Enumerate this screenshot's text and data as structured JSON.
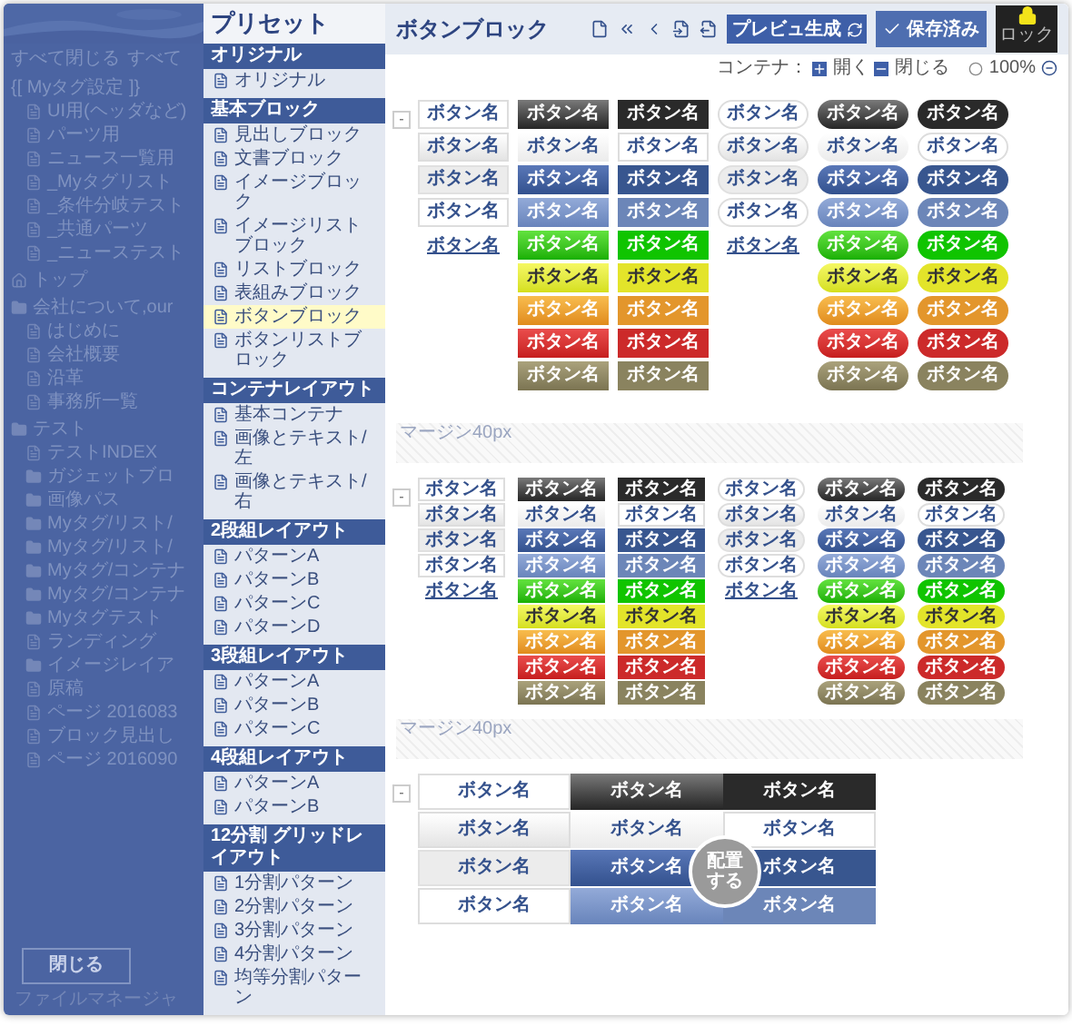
{
  "background_panel": {
    "toolbar": [
      "すべて閉じる",
      "すべて"
    ],
    "tree": [
      {
        "label": "{[ Myタグ設定 ]}",
        "kind": "plain",
        "children": [
          {
            "label": "UI用(ヘッダなど)",
            "kind": "page"
          },
          {
            "label": "パーツ用",
            "kind": "page"
          },
          {
            "label": "ニュース一覧用",
            "kind": "page"
          },
          {
            "label": "_Myタグリスト",
            "kind": "page"
          },
          {
            "label": "_条件分岐テスト",
            "kind": "page"
          },
          {
            "label": "_共通パーツ",
            "kind": "page"
          },
          {
            "label": "_ニューステスト",
            "kind": "page"
          }
        ]
      },
      {
        "label": "トップ",
        "kind": "home"
      },
      {
        "label": "会社について,our",
        "kind": "folder",
        "children": [
          {
            "label": "はじめに",
            "kind": "page"
          },
          {
            "label": "会社概要",
            "kind": "page"
          },
          {
            "label": "沿革",
            "kind": "page"
          },
          {
            "label": "事務所一覧",
            "kind": "page"
          }
        ]
      },
      {
        "label": "テスト",
        "kind": "folder",
        "children": [
          {
            "label": "テストINDEX",
            "kind": "page"
          },
          {
            "label": "ガジェットブロ",
            "kind": "folder"
          },
          {
            "label": "画像パス",
            "kind": "folder"
          },
          {
            "label": "Myタグ/リスト/",
            "kind": "folder"
          },
          {
            "label": "Myタグ/リスト/",
            "kind": "folder"
          },
          {
            "label": "Myタグ/コンテナ",
            "kind": "folder"
          },
          {
            "label": "Myタグ/コンテナ",
            "kind": "folder"
          },
          {
            "label": "Myタグテスト",
            "kind": "folder"
          },
          {
            "label": "ランディング",
            "kind": "page"
          },
          {
            "label": "イメージレイア",
            "kind": "folder"
          },
          {
            "label": "原稿",
            "kind": "page"
          },
          {
            "label": "ページ 2016083",
            "kind": "page"
          },
          {
            "label": "ブロック見出し",
            "kind": "page"
          },
          {
            "label": "ページ 2016090",
            "kind": "page"
          }
        ]
      }
    ],
    "close_button": "閉じる",
    "footer": "ファイルマネージャ"
  },
  "presets": {
    "title": "プリセット",
    "groups": [
      {
        "title": "オリジナル",
        "items": [
          {
            "label": "オリジナル",
            "selected": false
          }
        ]
      },
      {
        "title": "基本ブロック",
        "items": [
          {
            "label": "見出しブロック",
            "selected": false
          },
          {
            "label": "文書ブロック",
            "selected": false
          },
          {
            "label": "イメージブロック",
            "selected": false
          },
          {
            "label": "イメージリストブロック",
            "selected": false
          },
          {
            "label": "リストブロック",
            "selected": false
          },
          {
            "label": "表組みブロック",
            "selected": false
          },
          {
            "label": "ボタンブロック",
            "selected": true
          },
          {
            "label": "ボタンリストブロック",
            "selected": false
          }
        ]
      },
      {
        "title": "コンテナレイアウト",
        "items": [
          {
            "label": "基本コンテナ",
            "selected": false
          },
          {
            "label": "画像とテキスト/左",
            "selected": false
          },
          {
            "label": "画像とテキスト/右",
            "selected": false
          }
        ]
      },
      {
        "title": "2段組レイアウト",
        "items": [
          {
            "label": "パターンA",
            "selected": false
          },
          {
            "label": "パターンB",
            "selected": false
          },
          {
            "label": "パターンC",
            "selected": false
          },
          {
            "label": "パターンD",
            "selected": false
          }
        ]
      },
      {
        "title": "3段組レイアウト",
        "items": [
          {
            "label": "パターンA",
            "selected": false
          },
          {
            "label": "パターンB",
            "selected": false
          },
          {
            "label": "パターンC",
            "selected": false
          }
        ]
      },
      {
        "title": "4段組レイアウト",
        "items": [
          {
            "label": "パターンA",
            "selected": false
          },
          {
            "label": "パターンB",
            "selected": false
          }
        ]
      },
      {
        "title": "12分割 グリッドレイアウト",
        "items": [
          {
            "label": "1分割パターン",
            "selected": false
          },
          {
            "label": "2分割パターン",
            "selected": false
          },
          {
            "label": "3分割パターン",
            "selected": false
          },
          {
            "label": "4分割パターン",
            "selected": false
          },
          {
            "label": "均等分割パターン",
            "selected": false
          }
        ]
      }
    ]
  },
  "editor": {
    "title": "ボタンブロック",
    "preview_button": "プレビュ生成",
    "save_button": "保存済み",
    "lock_button": "ロック",
    "container_label": "コンテナ：",
    "expand": "開く",
    "collapse": "閉じる",
    "zoom": "100%"
  },
  "blocks": [
    {
      "kind": "buttons",
      "toggle": "-",
      "columns": [
        {
          "buttons": [
            {
              "label": "ボタン名",
              "kind": "white"
            },
            {
              "label": "ボタン名",
              "kind": "light"
            },
            {
              "label": "ボタン名",
              "kind": "gray"
            },
            {
              "label": "ボタン名",
              "kind": "white"
            },
            {
              "label": "ボタン名",
              "kind": "link"
            }
          ]
        },
        {
          "buttons": [
            {
              "label": "ボタン名",
              "kind": "dark"
            },
            {
              "label": "ボタン名",
              "kind": "white"
            },
            {
              "label": "ボタン名",
              "kind": "blue"
            },
            {
              "label": "ボタン名",
              "kind": "light_blue"
            },
            {
              "label": "ボタン名",
              "kind": "green"
            },
            {
              "label": "ボタン名",
              "kind": "yellow"
            },
            {
              "label": "ボタン名",
              "kind": "orange"
            },
            {
              "label": "ボタン名",
              "kind": "red"
            },
            {
              "label": "ボタン名",
              "kind": "olive"
            }
          ]
        },
        {
          "buttons": [
            {
              "label": "ボタン名",
              "kind": "dark"
            },
            {
              "label": "ボタン名",
              "kind": "white"
            },
            {
              "label": "ボタン名",
              "kind": "blue"
            },
            {
              "label": "ボタン名",
              "kind": "light_blue"
            },
            {
              "label": "ボタン名",
              "kind": "green"
            },
            {
              "label": "ボタン名",
              "kind": "yellow"
            },
            {
              "label": "ボタン名",
              "kind": "orange"
            },
            {
              "label": "ボタン名",
              "kind": "red"
            },
            {
              "label": "ボタン名",
              "kind": "olive"
            }
          ]
        },
        {
          "buttons": [
            {
              "label": "ボタン名",
              "kind": "white"
            },
            {
              "label": "ボタン名",
              "kind": "light"
            },
            {
              "label": "ボタン名",
              "kind": "gray"
            },
            {
              "label": "ボタン名",
              "kind": "white"
            },
            {
              "label": "ボタン名",
              "kind": "link"
            }
          ]
        },
        {
          "buttons": [
            {
              "label": "ボタン名",
              "kind": "dark"
            },
            {
              "label": "ボタン名",
              "kind": "white"
            },
            {
              "label": "ボタン名",
              "kind": "blue"
            },
            {
              "label": "ボタン名",
              "kind": "light_blue"
            },
            {
              "label": "ボタン名",
              "kind": "green"
            },
            {
              "label": "ボタン名",
              "kind": "yellow"
            },
            {
              "label": "ボタン名",
              "kind": "orange"
            },
            {
              "label": "ボタン名",
              "kind": "red"
            },
            {
              "label": "ボタン名",
              "kind": "olive"
            }
          ]
        },
        {
          "buttons": [
            {
              "label": "ボタン名",
              "kind": "dark"
            },
            {
              "label": "ボタン名",
              "kind": "white"
            },
            {
              "label": "ボタン名",
              "kind": "blue"
            },
            {
              "label": "ボタン名",
              "kind": "light_blue"
            },
            {
              "label": "ボタン名",
              "kind": "green"
            },
            {
              "label": "ボタン名",
              "kind": "yellow"
            },
            {
              "label": "ボタン名",
              "kind": "orange"
            },
            {
              "label": "ボタン名",
              "kind": "red"
            },
            {
              "label": "ボタン名",
              "kind": "olive"
            }
          ]
        }
      ]
    },
    {
      "kind": "margin",
      "label": "マージン40px"
    },
    {
      "kind": "buttons",
      "toggle": "-",
      "columns": [
        {
          "buttons": [
            {
              "label": "ボタン名",
              "kind": "white"
            },
            {
              "label": "ボタン名",
              "kind": "light"
            },
            {
              "label": "ボタン名",
              "kind": "gray"
            },
            {
              "label": "ボタン名",
              "kind": "white"
            },
            {
              "label": "ボタン名",
              "kind": "link"
            }
          ]
        },
        {
          "buttons": [
            {
              "label": "ボタン名",
              "kind": "dark"
            },
            {
              "label": "ボタン名",
              "kind": "white"
            },
            {
              "label": "ボタン名",
              "kind": "blue"
            },
            {
              "label": "ボタン名",
              "kind": "light_blue"
            },
            {
              "label": "ボタン名",
              "kind": "green"
            },
            {
              "label": "ボタン名",
              "kind": "yellow"
            },
            {
              "label": "ボタン名",
              "kind": "orange"
            },
            {
              "label": "ボタン名",
              "kind": "red"
            },
            {
              "label": "ボタン名",
              "kind": "olive"
            }
          ]
        },
        {
          "buttons": [
            {
              "label": "ボタン名",
              "kind": "dark"
            },
            {
              "label": "ボタン名",
              "kind": "white"
            },
            {
              "label": "ボタン名",
              "kind": "blue"
            },
            {
              "label": "ボタン名",
              "kind": "light_blue"
            },
            {
              "label": "ボタン名",
              "kind": "green"
            },
            {
              "label": "ボタン名",
              "kind": "yellow"
            },
            {
              "label": "ボタン名",
              "kind": "orange"
            },
            {
              "label": "ボタン名",
              "kind": "red"
            },
            {
              "label": "ボタン名",
              "kind": "olive"
            }
          ]
        },
        {
          "buttons": [
            {
              "label": "ボタン名",
              "kind": "white"
            },
            {
              "label": "ボタン名",
              "kind": "light"
            },
            {
              "label": "ボタン名",
              "kind": "gray"
            },
            {
              "label": "ボタン名",
              "kind": "white"
            },
            {
              "label": "ボタン名",
              "kind": "link"
            }
          ]
        },
        {
          "buttons": [
            {
              "label": "ボタン名",
              "kind": "dark"
            },
            {
              "label": "ボタン名",
              "kind": "white"
            },
            {
              "label": "ボタン名",
              "kind": "blue"
            },
            {
              "label": "ボタン名",
              "kind": "light_blue"
            },
            {
              "label": "ボタン名",
              "kind": "green"
            },
            {
              "label": "ボタン名",
              "kind": "yellow"
            },
            {
              "label": "ボタン名",
              "kind": "orange"
            },
            {
              "label": "ボタン名",
              "kind": "red"
            },
            {
              "label": "ボタン名",
              "kind": "olive"
            }
          ]
        },
        {
          "buttons": [
            {
              "label": "ボタン名",
              "kind": "dark"
            },
            {
              "label": "ボタン名",
              "kind": "white"
            },
            {
              "label": "ボタン名",
              "kind": "blue"
            },
            {
              "label": "ボタン名",
              "kind": "light_blue"
            },
            {
              "label": "ボタン名",
              "kind": "green"
            },
            {
              "label": "ボタン名",
              "kind": "yellow"
            },
            {
              "label": "ボタン名",
              "kind": "orange"
            },
            {
              "label": "ボタン名",
              "kind": "red"
            },
            {
              "label": "ボタン名",
              "kind": "olive"
            }
          ]
        }
      ]
    },
    {
      "kind": "margin",
      "label": "マージン40px"
    },
    {
      "kind": "buttons",
      "toggle": "-",
      "drop_hint": "配置する",
      "columns": [
        {
          "buttons": [
            {
              "label": "ボタン名",
              "kind": "white"
            },
            {
              "label": "ボタン名",
              "kind": "light"
            },
            {
              "label": "ボタン名",
              "kind": "gray"
            },
            {
              "label": "ボタン名",
              "kind": "white"
            }
          ]
        },
        {
          "buttons": [
            {
              "label": "ボタン名",
              "kind": "dark"
            },
            {
              "label": "ボタン名",
              "kind": "white"
            },
            {
              "label": "ボタン名",
              "kind": "blue"
            },
            {
              "label": "ボタン名",
              "kind": "light_blue"
            }
          ]
        },
        {
          "buttons": [
            {
              "label": "ボタン名",
              "kind": "dark"
            },
            {
              "label": "ボタン名",
              "kind": "white"
            },
            {
              "label": "ボタン名",
              "kind": "blue"
            },
            {
              "label": "ボタン名",
              "kind": "light_blue"
            }
          ]
        }
      ]
    }
  ]
}
